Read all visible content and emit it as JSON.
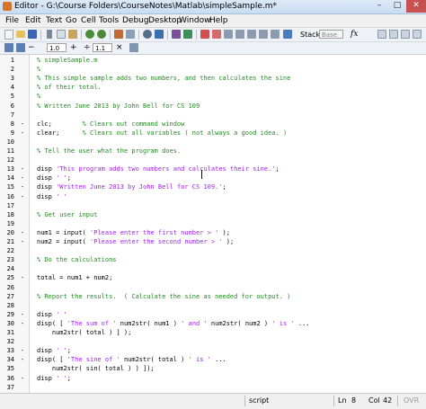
{
  "window": {
    "title": "Editor - G:\\Course Folders\\CourseNotes\\Matlab\\simpleSample.m*",
    "minimize": "–",
    "maximize": "□",
    "close": "✕"
  },
  "menubar": [
    "File",
    "Edit",
    "Text",
    "Go",
    "Cell",
    "Tools",
    "Debug",
    "Desktop",
    "Window",
    "Help"
  ],
  "toolbar": {
    "stack_label": "Stack:",
    "stack_value": "Base",
    "fx_label": "fx",
    "cell_minus": "−",
    "cell_value_1": "1.0",
    "cell_plus": "+",
    "cell_divide": "÷",
    "cell_value_2": "1.1",
    "cell_times": "×"
  },
  "colors": {
    "comment": "#228b22",
    "string": "#a020f0",
    "code": "#000000"
  },
  "lines": [
    {
      "num": "1",
      "dash": "",
      "tokens": [
        {
          "t": "c",
          "text": "% simpleSample.m"
        }
      ]
    },
    {
      "num": "2",
      "dash": "",
      "tokens": [
        {
          "t": "c",
          "text": "%"
        }
      ]
    },
    {
      "num": "3",
      "dash": "",
      "tokens": [
        {
          "t": "c",
          "text": "% This simple sample adds two numbers, and then calculates the sine"
        }
      ]
    },
    {
      "num": "4",
      "dash": "",
      "tokens": [
        {
          "t": "c",
          "text": "% of their total."
        }
      ]
    },
    {
      "num": "5",
      "dash": "",
      "tokens": [
        {
          "t": "c",
          "text": "%"
        }
      ]
    },
    {
      "num": "6",
      "dash": "",
      "tokens": [
        {
          "t": "c",
          "text": "% Written June 2013 by John Bell for CS 109"
        }
      ]
    },
    {
      "num": "7",
      "dash": "",
      "tokens": []
    },
    {
      "num": "8",
      "dash": "-",
      "tokens": [
        {
          "t": "n",
          "text": "clc;        "
        },
        {
          "t": "c",
          "text": "% Clears out command window"
        }
      ]
    },
    {
      "num": "9",
      "dash": "-",
      "tokens": [
        {
          "t": "n",
          "text": "clear;      "
        },
        {
          "t": "c",
          "text": "% Clears out all variables ( not always a good idea. )"
        }
      ]
    },
    {
      "num": "10",
      "dash": "",
      "tokens": []
    },
    {
      "num": "11",
      "dash": "",
      "tokens": [
        {
          "t": "c",
          "text": "% Tell the user what the program does."
        }
      ]
    },
    {
      "num": "12",
      "dash": "",
      "tokens": []
    },
    {
      "num": "13",
      "dash": "-",
      "tokens": [
        {
          "t": "n",
          "text": "disp "
        },
        {
          "t": "s",
          "text": "'This program adds two numbers and calculates their sine.'"
        },
        {
          "t": "n",
          "text": ";"
        }
      ]
    },
    {
      "num": "14",
      "dash": "-",
      "tokens": [
        {
          "t": "n",
          "text": "disp "
        },
        {
          "t": "s",
          "text": "' '"
        },
        {
          "t": "n",
          "text": ";"
        }
      ]
    },
    {
      "num": "15",
      "dash": "-",
      "tokens": [
        {
          "t": "n",
          "text": "disp "
        },
        {
          "t": "s",
          "text": "'Written June 2013 by John Bell for CS 109.'"
        },
        {
          "t": "n",
          "text": ";"
        }
      ]
    },
    {
      "num": "16",
      "dash": "-",
      "tokens": [
        {
          "t": "n",
          "text": "disp "
        },
        {
          "t": "s",
          "text": "' '"
        }
      ]
    },
    {
      "num": "17",
      "dash": "",
      "tokens": []
    },
    {
      "num": "18",
      "dash": "",
      "tokens": [
        {
          "t": "c",
          "text": "% Get user input"
        }
      ]
    },
    {
      "num": "19",
      "dash": "",
      "tokens": []
    },
    {
      "num": "20",
      "dash": "-",
      "tokens": [
        {
          "t": "n",
          "text": "num1 = input( "
        },
        {
          "t": "s",
          "text": "'Please enter the first number > '"
        },
        {
          "t": "n",
          "text": " );"
        }
      ]
    },
    {
      "num": "21",
      "dash": "-",
      "tokens": [
        {
          "t": "n",
          "text": "num2 = input( "
        },
        {
          "t": "s",
          "text": "'Please enter the second number > '"
        },
        {
          "t": "n",
          "text": " );"
        }
      ]
    },
    {
      "num": "22",
      "dash": "",
      "tokens": []
    },
    {
      "num": "23",
      "dash": "",
      "tokens": [
        {
          "t": "c",
          "text": "% Do the calculations"
        }
      ]
    },
    {
      "num": "24",
      "dash": "",
      "tokens": []
    },
    {
      "num": "25",
      "dash": "-",
      "tokens": [
        {
          "t": "n",
          "text": "total = num1 + num2;"
        }
      ]
    },
    {
      "num": "26",
      "dash": "",
      "tokens": []
    },
    {
      "num": "27",
      "dash": "",
      "tokens": [
        {
          "t": "c",
          "text": "% Report the results.  ( Calculate the sine as needed for output. )"
        }
      ]
    },
    {
      "num": "28",
      "dash": "",
      "tokens": []
    },
    {
      "num": "29",
      "dash": "-",
      "tokens": [
        {
          "t": "n",
          "text": "disp "
        },
        {
          "t": "s",
          "text": "' '"
        }
      ]
    },
    {
      "num": "30",
      "dash": "-",
      "tokens": [
        {
          "t": "n",
          "text": "disp( [ "
        },
        {
          "t": "s",
          "text": "'The sum of '"
        },
        {
          "t": "n",
          "text": " num2str( num1 ) "
        },
        {
          "t": "s",
          "text": "' and '"
        },
        {
          "t": "n",
          "text": " num2str( num2 ) "
        },
        {
          "t": "s",
          "text": "' is '"
        },
        {
          "t": "n",
          "text": " ..."
        }
      ]
    },
    {
      "num": "31",
      "dash": "",
      "tokens": [
        {
          "t": "n",
          "text": "    num2str( total ) ] );"
        }
      ]
    },
    {
      "num": "32",
      "dash": "",
      "tokens": []
    },
    {
      "num": "33",
      "dash": "-",
      "tokens": [
        {
          "t": "n",
          "text": "disp "
        },
        {
          "t": "s",
          "text": "' '"
        },
        {
          "t": "n",
          "text": ";"
        }
      ]
    },
    {
      "num": "34",
      "dash": "-",
      "tokens": [
        {
          "t": "n",
          "text": "disp( [ "
        },
        {
          "t": "s",
          "text": "'The sine of '"
        },
        {
          "t": "n",
          "text": " num2str( total ) "
        },
        {
          "t": "s",
          "text": "' is '"
        },
        {
          "t": "n",
          "text": " ..."
        }
      ]
    },
    {
      "num": "35",
      "dash": "",
      "tokens": [
        {
          "t": "n",
          "text": "    num2str( sin( total ) ) ]);"
        }
      ]
    },
    {
      "num": "36",
      "dash": "-",
      "tokens": [
        {
          "t": "n",
          "text": "disp "
        },
        {
          "t": "s",
          "text": "' '"
        },
        {
          "t": "n",
          "text": ";"
        }
      ]
    },
    {
      "num": "37",
      "dash": "",
      "tokens": []
    }
  ],
  "status": {
    "mode": "script",
    "ln_label": "Ln",
    "ln_value": "8",
    "col_label": "Col",
    "col_value": "42",
    "ovr": "OVR"
  }
}
